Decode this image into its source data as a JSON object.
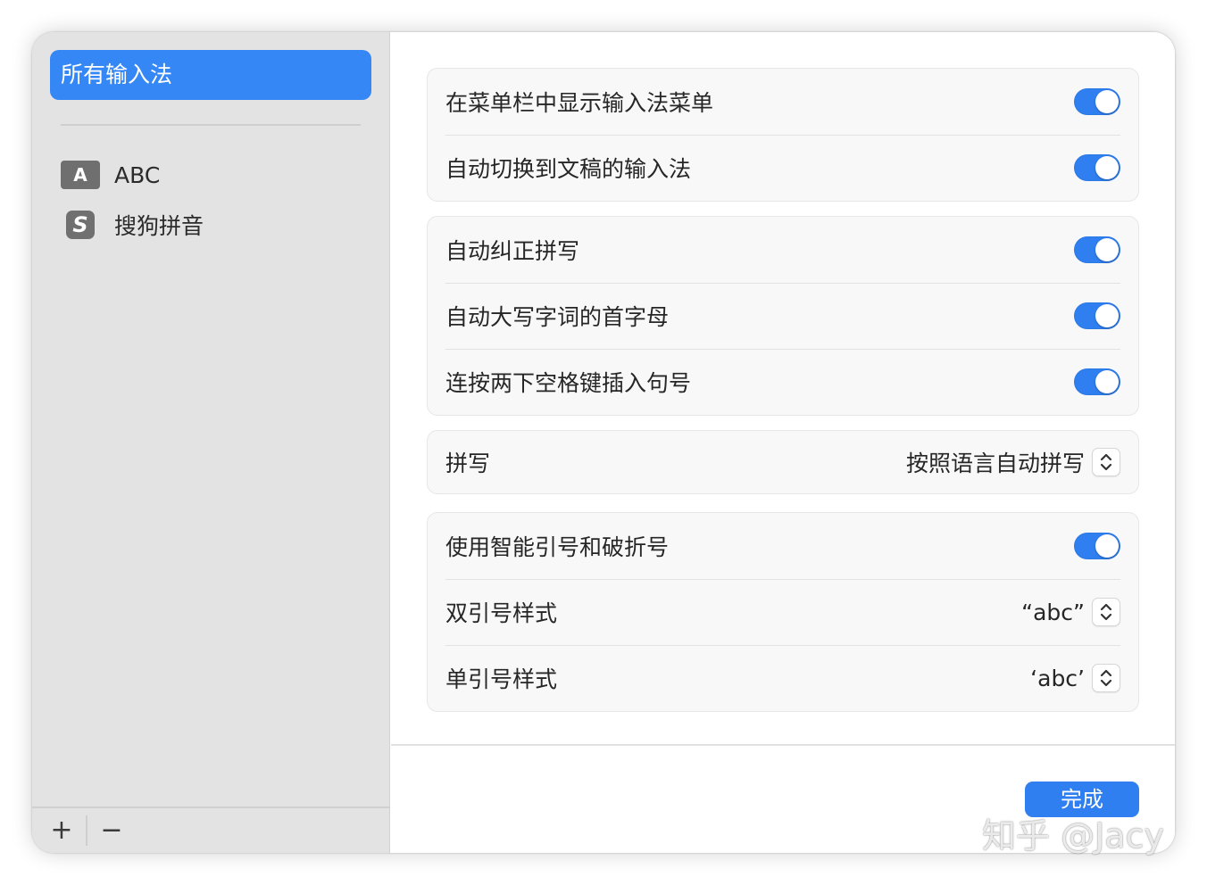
{
  "sidebar": {
    "selected_label": "所有输入法",
    "items": [
      {
        "icon": "abc-input-icon",
        "icon_text": "A",
        "label": "ABC"
      },
      {
        "icon": "sogou-input-icon",
        "icon_text": "S",
        "label": "搜狗拼音"
      }
    ],
    "add_label": "+",
    "remove_label": "−"
  },
  "settings": {
    "group1": {
      "show_menu_label": "在菜单栏中显示输入法菜单",
      "show_menu_on": true,
      "auto_switch_label": "自动切换到文稿的输入法",
      "auto_switch_on": true
    },
    "group2": {
      "autocorrect_label": "自动纠正拼写",
      "autocorrect_on": true,
      "capitalize_label": "自动大写字词的首字母",
      "capitalize_on": true,
      "period_label": "连按两下空格键插入句号",
      "period_on": true
    },
    "group3": {
      "spelling_label": "拼写",
      "spelling_value": "按照语言自动拼写"
    },
    "group4": {
      "smart_quotes_label": "使用智能引号和破折号",
      "smart_quotes_on": true,
      "double_quote_label": "双引号样式",
      "double_quote_value": "“abc”",
      "single_quote_label": "单引号样式",
      "single_quote_value": "‘abc’"
    }
  },
  "footer": {
    "done_label": "完成"
  },
  "watermark": "知乎 @Jacy",
  "colors": {
    "accent": "#2f7ff1",
    "sidebar_selected": "#3587f5",
    "sidebar_bg": "#e3e3e3"
  }
}
